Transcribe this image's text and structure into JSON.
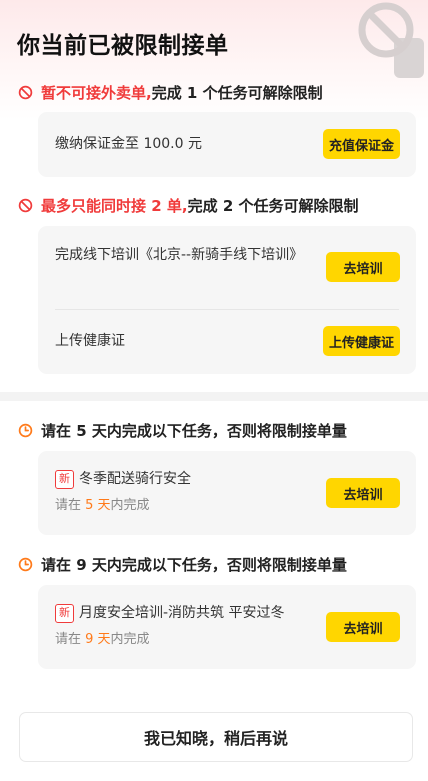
{
  "page": {
    "title": "你当前已被限制接单"
  },
  "colors": {
    "red": "#f03b3b",
    "orange": "#ff7a1a",
    "yellow": "#ffd600"
  },
  "restrictions": [
    {
      "icon": "prohibit-icon",
      "title_highlight": "暂不可接外卖单,",
      "title_rest": " 完成 1 个任务可解除限制",
      "tasks": [
        {
          "label": "缴纳保证金至 100.0 元",
          "button": "充值保证金"
        }
      ]
    },
    {
      "icon": "prohibit-icon",
      "title_highlight": "最多只能同时接 2 单,",
      "title_rest": " 完成 2 个任务可解除限制",
      "tasks": [
        {
          "label": "完成线下培训《北京--新骑手线下培训》",
          "button": "去培训"
        },
        {
          "label": "上传健康证",
          "button": "上传健康证"
        }
      ]
    }
  ],
  "deadlines": [
    {
      "icon": "clock-icon",
      "title": "请在 5 天内完成以下任务，否则将限制接单量",
      "badge": "新",
      "task": "冬季配送骑行安全",
      "sub_prefix": "请在 ",
      "sub_highlight": "5 天",
      "sub_suffix": "内完成",
      "button": "去培训"
    },
    {
      "icon": "clock-icon",
      "title": "请在 9 天内完成以下任务，否则将限制接单量",
      "badge": "新",
      "task": "月度安全培训-消防共筑 平安过冬",
      "sub_prefix": "请在 ",
      "sub_highlight": "9 天",
      "sub_suffix": "内完成",
      "button": "去培训"
    }
  ],
  "footer": {
    "button": "我已知晓，稍后再说"
  }
}
